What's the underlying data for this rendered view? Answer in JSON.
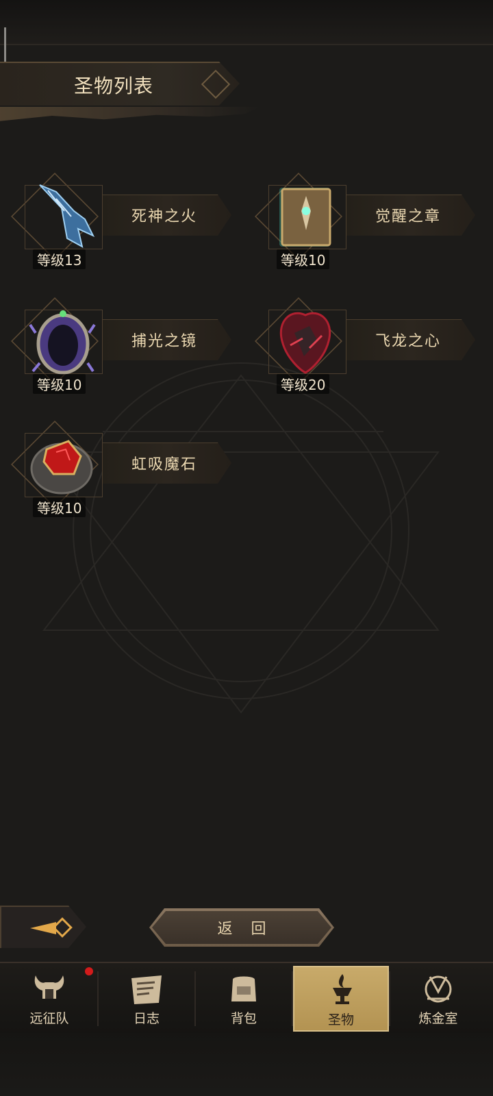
{
  "header": {
    "title": "圣物列表"
  },
  "relics": [
    {
      "name": "死神之火",
      "level": "等级13",
      "icon": "spectral-claw-icon",
      "color": "#6fa6d8"
    },
    {
      "name": "觉醒之章",
      "level": "等级10",
      "icon": "ancient-tome-icon",
      "color": "#3cc6b0"
    },
    {
      "name": "捕光之镜",
      "level": "等级10",
      "icon": "crystal-mirror-icon",
      "color": "#7a6ad0"
    },
    {
      "name": "飞龙之心",
      "level": "等级20",
      "icon": "dragon-heart-icon",
      "color": "#b02030"
    },
    {
      "name": "虹吸魔石",
      "level": "等级10",
      "icon": "siphon-stone-icon",
      "color": "#d02020"
    }
  ],
  "actions": {
    "back_label": "返 回"
  },
  "tabs": [
    {
      "label": "远征队",
      "icon": "horned-helmet-icon",
      "active": false,
      "badge": true
    },
    {
      "label": "日志",
      "icon": "scroll-icon",
      "active": false
    },
    {
      "label": "背包",
      "icon": "backpack-icon",
      "active": false
    },
    {
      "label": "圣物",
      "icon": "chalice-flame-icon",
      "active": true
    },
    {
      "label": "炼金室",
      "icon": "alchemy-icon",
      "active": false
    }
  ],
  "colors": {
    "accent": "#c8aa6a",
    "badge": "#d21b1b",
    "text": "#e8d7b5"
  }
}
